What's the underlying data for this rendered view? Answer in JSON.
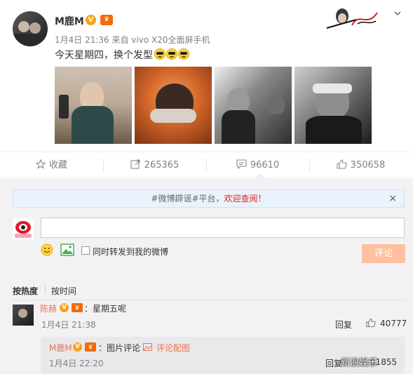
{
  "post": {
    "username": "M鹿M",
    "verified_badge": "V",
    "member_badge": "vip",
    "meta": "1月4日 21:36 来自 vivo X20全面屏手机",
    "text": "今天星期四，换个发型",
    "emoji_count": 3,
    "emoji_icon": "sunglasses-emoji-icon",
    "photos": [
      {
        "icon": "photo-bathroom-selfie"
      },
      {
        "icon": "photo-hair-back"
      },
      {
        "icon": "photo-mirror-bw"
      },
      {
        "icon": "photo-closeup-bw"
      }
    ]
  },
  "actions": {
    "favorite": "收藏",
    "repost_count": "265365",
    "comment_count": "96610",
    "like_count": "350658"
  },
  "notice": {
    "prefix": "#微博辟谣#平台，",
    "highlight": "欢迎查阅！",
    "close": "×"
  },
  "composer": {
    "input_value": "",
    "repost_label": "同时转发到我的微博",
    "submit_label": "评论"
  },
  "sort": {
    "hot": "按热度",
    "time": "按时间"
  },
  "comments": [
    {
      "name": "陈赫",
      "badge_v": "V",
      "badge_m": "vip",
      "text": "：星期五呢",
      "time": "1月4日 21:38",
      "reply": "回复",
      "likes": "40777"
    }
  ],
  "sub_comment": {
    "name": "M鹿M",
    "badge_v": "V",
    "badge_m": "vip",
    "text": "：图片评论",
    "link": "评论配图",
    "time": "1月4日 22:20",
    "reply": "回复",
    "likes": "11855"
  },
  "watermark": "新浪娱乐",
  "colors": {
    "accent_orange": "#eb7350",
    "submit_bg": "#ffc09f",
    "notice_bg": "#eaf3fb",
    "comments_bg": "#f2f2f5"
  }
}
